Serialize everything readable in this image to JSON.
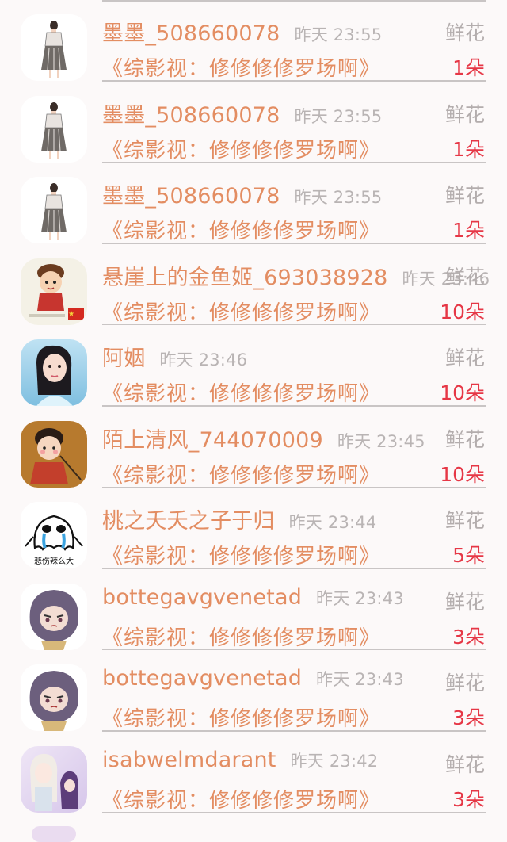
{
  "labels": {
    "gift_type": "鲜花"
  },
  "rows": [
    {
      "name": "墨墨_508660078",
      "time": "昨天 23:55",
      "book": "《综影视：修修修修罗场啊》",
      "count": "1朵",
      "avatar_icon": "girl-dress-avatar-icon"
    },
    {
      "name": "墨墨_508660078",
      "time": "昨天 23:55",
      "book": "《综影视：修修修修罗场啊》",
      "count": "1朵",
      "avatar_icon": "girl-dress-avatar-icon"
    },
    {
      "name": "墨墨_508660078",
      "time": "昨天 23:55",
      "book": "《综影视：修修修修罗场啊》",
      "count": "1朵",
      "avatar_icon": "girl-dress-avatar-icon"
    },
    {
      "name": "悬崖上的金鱼姬_693038928",
      "time": "昨天 23:46",
      "book": "《综影视：修修修修罗场啊》",
      "count": "10朵",
      "avatar_icon": "cartoon-boy-flag-avatar-icon"
    },
    {
      "name": "阿姻",
      "time": "昨天 23:46",
      "book": "《综影视：修修修修罗场啊》",
      "count": "10朵",
      "avatar_icon": "actress-avatar-icon"
    },
    {
      "name": "陌上清风_744070009",
      "time": "昨天 23:45",
      "book": "《综影视：修修修修罗场啊》",
      "count": "10朵",
      "avatar_icon": "cartoon-girl-avatar-icon"
    },
    {
      "name": "桃之夭夭之子于归",
      "time": "昨天 23:44",
      "book": "《综影视：修修修修罗场啊》",
      "count": "5朵",
      "avatar_icon": "crying-ghost-avatar-icon",
      "avatar_caption": "悲伤辣么大"
    },
    {
      "name": "bottegavgvenetad",
      "time": "昨天 23:43",
      "book": "《综影视：修修修修罗场啊》",
      "count": "3朵",
      "avatar_icon": "purple-hair-avatar-icon"
    },
    {
      "name": "bottegavgvenetad",
      "time": "昨天 23:43",
      "book": "《综影视：修修修修罗场啊》",
      "count": "3朵",
      "avatar_icon": "purple-hair-avatar-icon"
    },
    {
      "name": "isabwelmdarant",
      "time": "昨天 23:42",
      "book": "《综影视：修修修修罗场啊》",
      "count": "3朵",
      "avatar_icon": "anime-girls-avatar-icon"
    }
  ]
}
